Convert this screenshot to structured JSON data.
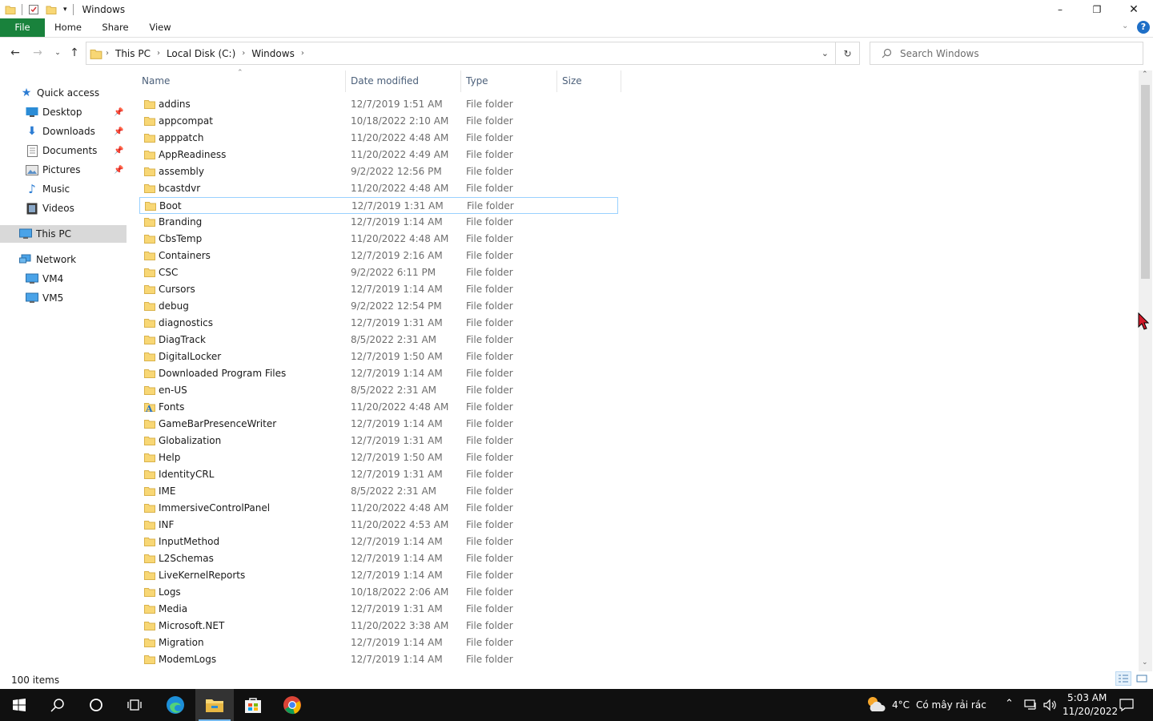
{
  "window": {
    "title": "Windows",
    "minimize_label": "–",
    "maximize_label": "❐",
    "close_label": "✕"
  },
  "ribbon": {
    "tabs": [
      {
        "label": "File"
      },
      {
        "label": "Home"
      },
      {
        "label": "Share"
      },
      {
        "label": "View"
      }
    ],
    "help_label": "?"
  },
  "address": {
    "crumbs": [
      "This PC",
      "Local Disk (C:)",
      "Windows"
    ]
  },
  "search": {
    "placeholder": "Search Windows"
  },
  "navpane": {
    "quick_access": "Quick access",
    "items": [
      {
        "label": "Desktop",
        "icon": "desktop-icon",
        "pinned": true
      },
      {
        "label": "Downloads",
        "icon": "download-icon",
        "pinned": true
      },
      {
        "label": "Documents",
        "icon": "documents-icon",
        "pinned": true
      },
      {
        "label": "Pictures",
        "icon": "pictures-icon",
        "pinned": true
      },
      {
        "label": "Music",
        "icon": "music-icon",
        "pinned": false
      },
      {
        "label": "Videos",
        "icon": "videos-icon",
        "pinned": false
      }
    ],
    "this_pc": "This PC",
    "network": "Network",
    "network_items": [
      {
        "label": "VM4"
      },
      {
        "label": "VM5"
      }
    ]
  },
  "columns": {
    "name": "Name",
    "date": "Date modified",
    "type": "Type",
    "size": "Size"
  },
  "files": [
    {
      "name": "addins",
      "date": "12/7/2019 1:51 AM",
      "type": "File folder"
    },
    {
      "name": "appcompat",
      "date": "10/18/2022 2:10 AM",
      "type": "File folder"
    },
    {
      "name": "apppatch",
      "date": "11/20/2022 4:48 AM",
      "type": "File folder"
    },
    {
      "name": "AppReadiness",
      "date": "11/20/2022 4:49 AM",
      "type": "File folder"
    },
    {
      "name": "assembly",
      "date": "9/2/2022 12:56 PM",
      "type": "File folder"
    },
    {
      "name": "bcastdvr",
      "date": "11/20/2022 4:48 AM",
      "type": "File folder"
    },
    {
      "name": "Boot",
      "date": "12/7/2019 1:31 AM",
      "type": "File folder",
      "focused": true
    },
    {
      "name": "Branding",
      "date": "12/7/2019 1:14 AM",
      "type": "File folder"
    },
    {
      "name": "CbsTemp",
      "date": "11/20/2022 4:48 AM",
      "type": "File folder"
    },
    {
      "name": "Containers",
      "date": "12/7/2019 2:16 AM",
      "type": "File folder"
    },
    {
      "name": "CSC",
      "date": "9/2/2022 6:11 PM",
      "type": "File folder"
    },
    {
      "name": "Cursors",
      "date": "12/7/2019 1:14 AM",
      "type": "File folder"
    },
    {
      "name": "debug",
      "date": "9/2/2022 12:54 PM",
      "type": "File folder"
    },
    {
      "name": "diagnostics",
      "date": "12/7/2019 1:31 AM",
      "type": "File folder"
    },
    {
      "name": "DiagTrack",
      "date": "8/5/2022 2:31 AM",
      "type": "File folder"
    },
    {
      "name": "DigitalLocker",
      "date": "12/7/2019 1:50 AM",
      "type": "File folder"
    },
    {
      "name": "Downloaded Program Files",
      "date": "12/7/2019 1:14 AM",
      "type": "File folder"
    },
    {
      "name": "en-US",
      "date": "8/5/2022 2:31 AM",
      "type": "File folder"
    },
    {
      "name": "Fonts",
      "date": "11/20/2022 4:48 AM",
      "type": "File folder",
      "special": "fonts"
    },
    {
      "name": "GameBarPresenceWriter",
      "date": "12/7/2019 1:14 AM",
      "type": "File folder"
    },
    {
      "name": "Globalization",
      "date": "12/7/2019 1:31 AM",
      "type": "File folder"
    },
    {
      "name": "Help",
      "date": "12/7/2019 1:50 AM",
      "type": "File folder"
    },
    {
      "name": "IdentityCRL",
      "date": "12/7/2019 1:31 AM",
      "type": "File folder"
    },
    {
      "name": "IME",
      "date": "8/5/2022 2:31 AM",
      "type": "File folder"
    },
    {
      "name": "ImmersiveControlPanel",
      "date": "11/20/2022 4:48 AM",
      "type": "File folder"
    },
    {
      "name": "INF",
      "date": "11/20/2022 4:53 AM",
      "type": "File folder"
    },
    {
      "name": "InputMethod",
      "date": "12/7/2019 1:14 AM",
      "type": "File folder"
    },
    {
      "name": "L2Schemas",
      "date": "12/7/2019 1:14 AM",
      "type": "File folder"
    },
    {
      "name": "LiveKernelReports",
      "date": "12/7/2019 1:14 AM",
      "type": "File folder"
    },
    {
      "name": "Logs",
      "date": "10/18/2022 2:06 AM",
      "type": "File folder"
    },
    {
      "name": "Media",
      "date": "12/7/2019 1:31 AM",
      "type": "File folder"
    },
    {
      "name": "Microsoft.NET",
      "date": "11/20/2022 3:38 AM",
      "type": "File folder"
    },
    {
      "name": "Migration",
      "date": "12/7/2019 1:14 AM",
      "type": "File folder"
    },
    {
      "name": "ModemLogs",
      "date": "12/7/2019 1:14 AM",
      "type": "File folder"
    }
  ],
  "status": {
    "items_count": "100 items"
  },
  "taskbar": {
    "weather_temp": "4°C",
    "weather_desc": "Có mây rải rác",
    "time": "5:03 AM",
    "date": "11/20/2022"
  },
  "colors": {
    "file_tab": "#19823c",
    "folder": "#f8d775",
    "focus_border": "#99d1ff",
    "taskbar": "#101010"
  }
}
